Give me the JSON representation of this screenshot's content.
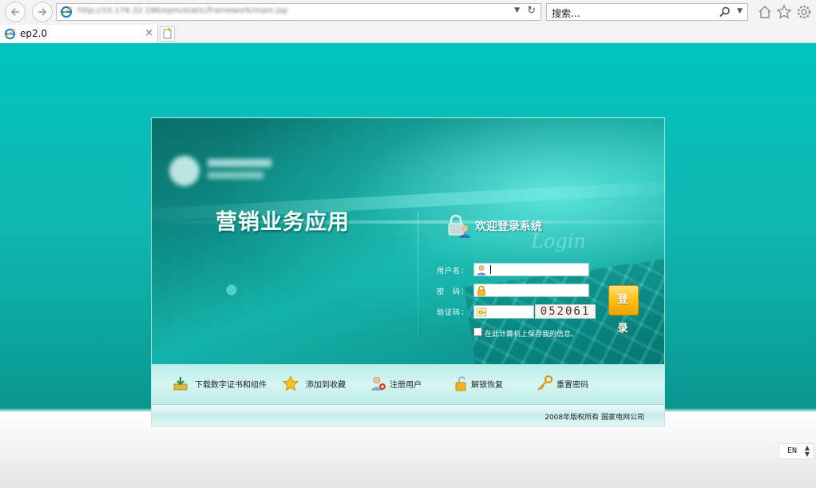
{
  "browser": {
    "address": {
      "url": "http://10.176.32.186/epm/static/framework/main.jsp"
    },
    "search": {
      "placeholder": "搜索..."
    },
    "tabs": [
      {
        "title": "ep2.0"
      }
    ]
  },
  "page": {
    "app_title": "营销业务应用",
    "welcome": "欢迎登录系统",
    "welcome_ghost": "Login",
    "form": {
      "username_label": "用户名：",
      "password_label": "密　码：",
      "captcha_label": "验证码：",
      "username_value": "",
      "password_value": "",
      "captcha_value": "",
      "captcha_image_text": "052061",
      "remember_label": "在此计算机上保存我的信息。",
      "remember_checked": false,
      "login_button": "登 录"
    },
    "links": [
      {
        "label": "下载数字证书和组件",
        "icon": "download-icon"
      },
      {
        "label": "添加到收藏",
        "icon": "star-icon"
      },
      {
        "label": "注册用户",
        "icon": "user-add-icon"
      },
      {
        "label": "解锁恢复",
        "icon": "unlock-icon"
      },
      {
        "label": "重置密码",
        "icon": "key-icon"
      }
    ],
    "footer": {
      "copyright": "2008年版权所有 国家电网公司"
    },
    "language": "EN"
  }
}
